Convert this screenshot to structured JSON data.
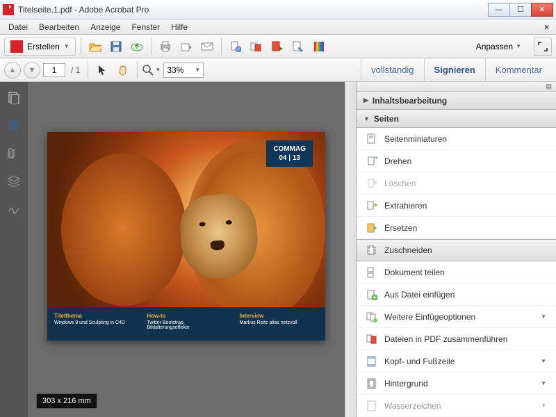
{
  "window": {
    "title": "Titelseite.1.pdf - Adobe Acrobat Pro"
  },
  "menu": [
    "Datei",
    "Bearbeiten",
    "Anzeige",
    "Fenster",
    "Hilfe"
  ],
  "toolbar": {
    "create_label": "Erstellen",
    "customize_label": "Anpassen"
  },
  "nav": {
    "page_current": "1",
    "page_total": "/ 1",
    "zoom": "33%"
  },
  "right_tabs": {
    "vollstaendig": "vollständig",
    "signieren": "Signieren",
    "kommentar": "Kommentar"
  },
  "panel": {
    "inhaltsbearbeitung": "Inhaltsbearbeitung",
    "seiten": "Seiten",
    "items": [
      "Seitenminiaturen",
      "Drehen",
      "Löschen",
      "Extrahieren",
      "Ersetzen",
      "Zuschneiden",
      "Dokument teilen",
      "Aus Datei einfügen",
      "Weitere Einfügeoptionen",
      "Dateien in PDF zusammenführen",
      "Kopf- und Fußzeile",
      "Hintergrund",
      "Wasserzeichen"
    ]
  },
  "document": {
    "badge_line1": "COMMAG",
    "badge_line2": "04 | 13",
    "col1_h": "Titelthema",
    "col1_t": "Windows 8 und Sculpting in C4D",
    "col2_h": "How-to",
    "col2_t": "Twitter Bootstrap, Bildalterungseffekte",
    "col3_h": "Interview",
    "col3_t": "Markus Reitz alias netzvoll",
    "dimensions": "303 x 216 mm"
  }
}
